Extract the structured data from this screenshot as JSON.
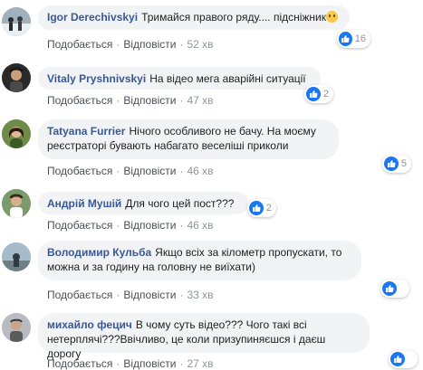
{
  "comments": [
    {
      "author": "Igor Derechivskyi",
      "text": "Тримайся правого ряду.... підсніжник",
      "reactions": "16",
      "like": "Подобається",
      "reply": "Відповісти",
      "time": "52 хв",
      "avatar_color": "#7a8a98"
    },
    {
      "author": "Vitaly Pryshnivskyi",
      "text": "На відео мега аварійні ситуації",
      "reactions": "2",
      "like": "Подобається",
      "reply": "Відповісти",
      "time": "47 хв",
      "avatar_color": "#3a3a3a"
    },
    {
      "author": "Tatyana Furrier",
      "text": "Нічого особливого не бачу. На моєму реєстраторі бувають набагато веселіші приколи",
      "reactions": "5",
      "like": "Подобається",
      "reply": "Відповісти",
      "time": "46 хв",
      "avatar_color": "#5a7a3a"
    },
    {
      "author": "Андрій Мушій",
      "text": "Для чого цей пост???",
      "reactions": "2",
      "like": "Подобається",
      "reply": "Відповісти",
      "time": "46 хв",
      "avatar_color": "#6b8a5a"
    },
    {
      "author": "Володимир Кульба",
      "text": "Якщо всіх за кілометр пропускати, то можна и за годину на головну не виїхати)",
      "reactions": "",
      "like": "Подобається",
      "reply": "Відповісти",
      "time": "33 хв",
      "avatar_color": "#7a8e9e"
    },
    {
      "author": "михайло фецич",
      "text": "В чому суть відео??? Чого такі всі нетерплячі???Ввічливо, це коли призупиняєшся і даєш дорогу",
      "reactions": "",
      "like": "Подобається",
      "reply": "Відповісти",
      "time": "27 хв",
      "avatar_color": "#8a8a8a"
    }
  ],
  "colors": {
    "author": "#385898",
    "bubble": "#f2f3f5",
    "like_blue": "#1877f2",
    "meta": "#90949c"
  },
  "icons": {
    "like": "thumbs-up-icon",
    "emoji": "grinning-face-icon"
  }
}
